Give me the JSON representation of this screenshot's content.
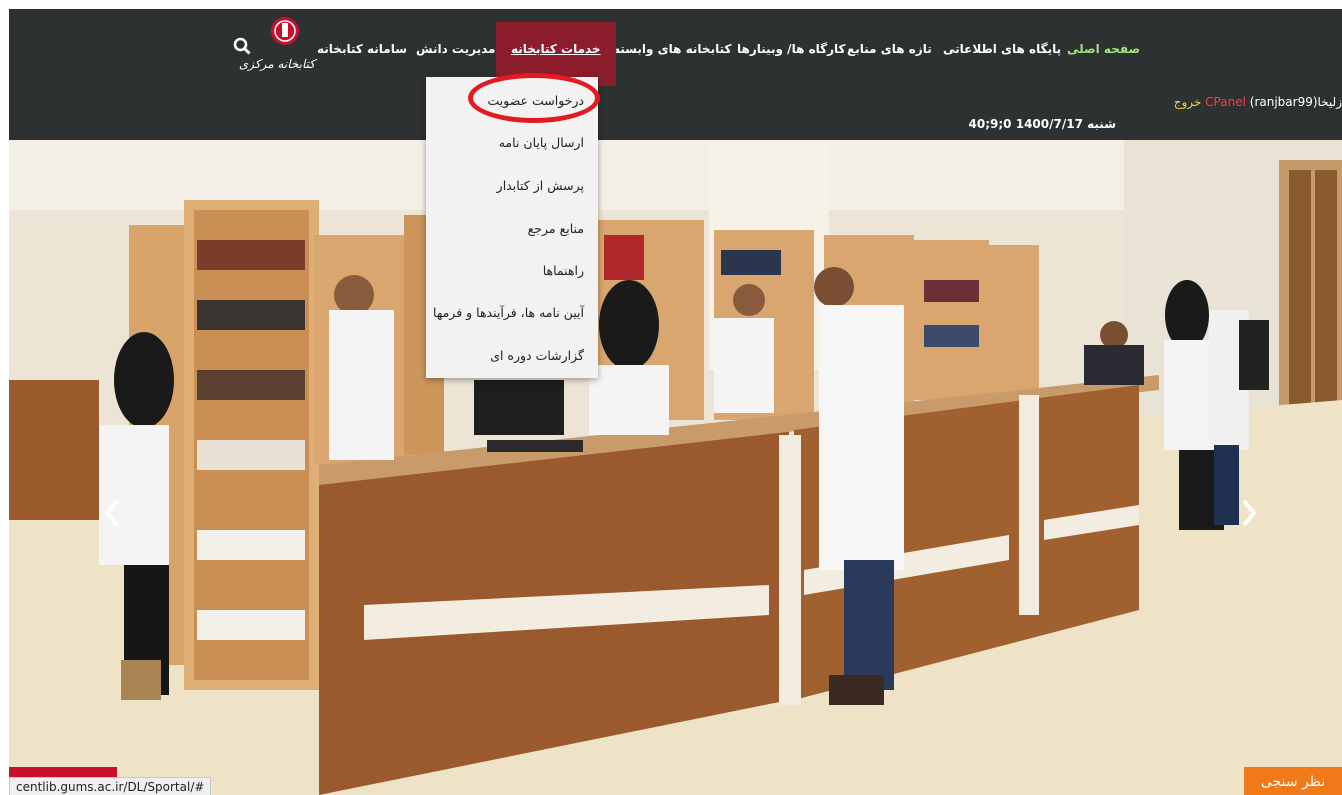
{
  "nav": {
    "items": [
      {
        "label": "صفحه اصلی"
      },
      {
        "label": "پایگاه های اطلاعاتی"
      },
      {
        "label": "تازه های منابع"
      },
      {
        "label": "کارگاه ها/ وبینارها"
      },
      {
        "label": "کتابخانه های وابسته"
      },
      {
        "label": "خدمات کتابخانه"
      },
      {
        "label": "مدیریت دانش"
      },
      {
        "label": "سامانه کتابخانه"
      }
    ],
    "search_icon": "search-icon",
    "logo_text": "کتابخانه مرکزی"
  },
  "info": {
    "user": "زلیخا(ranjbar99)",
    "cpanel": "CPanel",
    "logout": "خروج",
    "datetime": "شنبه 1400/7/17 0;9;40"
  },
  "dropdown": {
    "items": [
      {
        "label": "درخواست عضویت"
      },
      {
        "label": "ارسال پایان نامه"
      },
      {
        "label": "پرسش از کتابدار"
      },
      {
        "label": "منابع مرجع"
      },
      {
        "label": "راهنماها"
      },
      {
        "label": "آیین نامه ها، فرآیندها و فرمها"
      },
      {
        "label": "گزارشات دوره ای"
      }
    ]
  },
  "status_url": "centlib.gums.ac.ir/DL/Sportal/#",
  "survey_label": "نظر سنجی",
  "colors": {
    "nav_bg": "#2e3132",
    "active_bg": "#8b1d2c",
    "highlight": "#e21b23",
    "survey": "#f07a1a"
  }
}
